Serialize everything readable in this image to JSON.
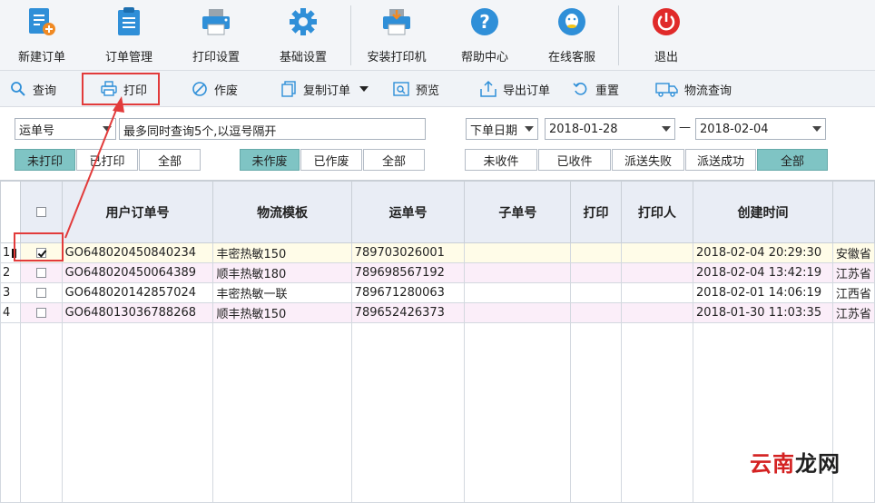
{
  "toolbar": {
    "items": [
      {
        "label": "新建订单",
        "icon": "new-order-icon"
      },
      {
        "label": "订单管理",
        "icon": "order-management-icon"
      },
      {
        "label": "打印设置",
        "icon": "printer-settings-icon"
      },
      {
        "label": "基础设置",
        "icon": "gear-icon"
      },
      {
        "label": "安装打印机",
        "icon": "install-printer-icon"
      },
      {
        "label": "帮助中心",
        "icon": "help-icon"
      },
      {
        "label": "在线客服",
        "icon": "chat-icon"
      },
      {
        "label": "退出",
        "icon": "power-icon"
      }
    ]
  },
  "actions": {
    "query": "查询",
    "print": "打印",
    "void": "作废",
    "copy_order": "复制订单",
    "preview": "预览",
    "export_order": "导出订单",
    "reset": "重置",
    "logistics_query": "物流查询"
  },
  "filters": {
    "search_type": "运单号",
    "search_placeholder": "最多同时查询5个,以逗号隔开",
    "date_type": "下单日期",
    "date_from": "2018-01-28",
    "date_sep": "—",
    "date_to": "2018-02-04",
    "print_status": [
      "未打印",
      "已打印",
      "全部"
    ],
    "void_status": [
      "未作废",
      "已作废",
      "全部"
    ],
    "receive_status": [
      "未收件",
      "已收件",
      "派送失败",
      "派送成功",
      "全部"
    ]
  },
  "table": {
    "columns": [
      "用户订单号",
      "物流模板",
      "运单号",
      "子单号",
      "打印",
      "打印人",
      "创建时间"
    ],
    "rows": [
      {
        "idx": "1",
        "checked": true,
        "order_no": "GO648020450840234",
        "template": "丰密热敏150",
        "waybill": "789703026001",
        "sub_no": "",
        "printed": "",
        "printer": "",
        "created": "2018-02-04 20:29:30",
        "extra": "安徽省"
      },
      {
        "idx": "2",
        "checked": false,
        "order_no": "GO648020450064389",
        "template": "顺丰热敏180",
        "waybill": "789698567192",
        "sub_no": "",
        "printed": "",
        "printer": "",
        "created": "2018-02-04 13:42:19",
        "extra": "江苏省"
      },
      {
        "idx": "3",
        "checked": false,
        "order_no": "GO648020142857024",
        "template": "丰密热敏一联",
        "waybill": "789671280063",
        "sub_no": "",
        "printed": "",
        "printer": "",
        "created": "2018-02-01 14:06:19",
        "extra": "江西省"
      },
      {
        "idx": "4",
        "checked": false,
        "order_no": "GO648013036788268",
        "template": "顺丰热敏150",
        "waybill": "789652426373",
        "sub_no": "",
        "printed": "",
        "printer": "",
        "created": "2018-01-30 11:03:35",
        "extra": "江苏省"
      }
    ]
  },
  "watermark": {
    "red": "云南",
    "dark": "龙网"
  },
  "colors": {
    "accent": "#7fc4c4",
    "highlight": "#e23b3b",
    "header_bg": "#e9edf5"
  }
}
